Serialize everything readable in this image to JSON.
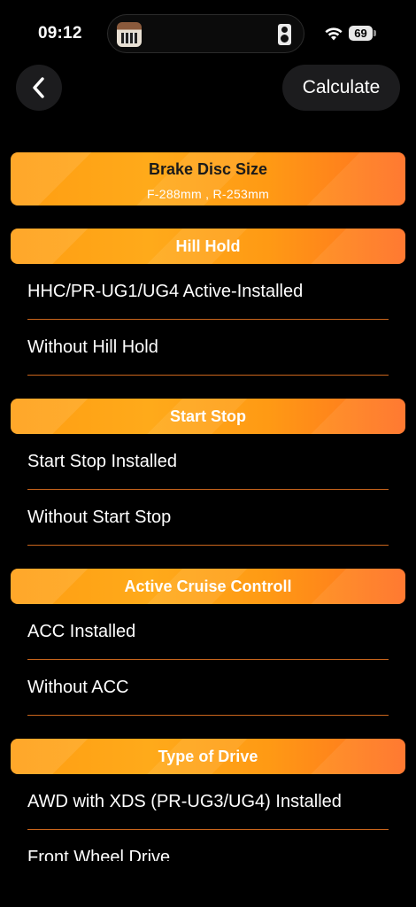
{
  "status_bar": {
    "time": "09:12",
    "battery": "69",
    "icons": [
      "app-thumbnail-icon",
      "speaker-icon",
      "wifi-icon",
      "battery-icon"
    ]
  },
  "nav": {
    "back_icon": "chevron-left-icon",
    "calculate_label": "Calculate"
  },
  "brake_disc": {
    "title": "Brake Disc Size",
    "subtitle": "F-288mm , R-253mm"
  },
  "sections": [
    {
      "title": "Hill Hold",
      "options": [
        "HHC/PR-UG1/UG4 Active-Installed",
        "Without Hill Hold"
      ]
    },
    {
      "title": "Start Stop",
      "options": [
        "Start Stop Installed",
        "Without Start Stop"
      ]
    },
    {
      "title": "Active Cruise Controll",
      "options": [
        "ACC Installed",
        "Without ACC"
      ]
    },
    {
      "title": "Type of Drive",
      "options": [
        "AWD with XDS (PR-UG3/UG4) Installed",
        "Front Wheel Drive"
      ]
    }
  ],
  "colors": {
    "accent_orange": "#ff9d12",
    "accent_orange_dark": "#ff6f22",
    "divider": "#c9651c",
    "background": "#000000",
    "button_bg": "#1c1c1e"
  }
}
